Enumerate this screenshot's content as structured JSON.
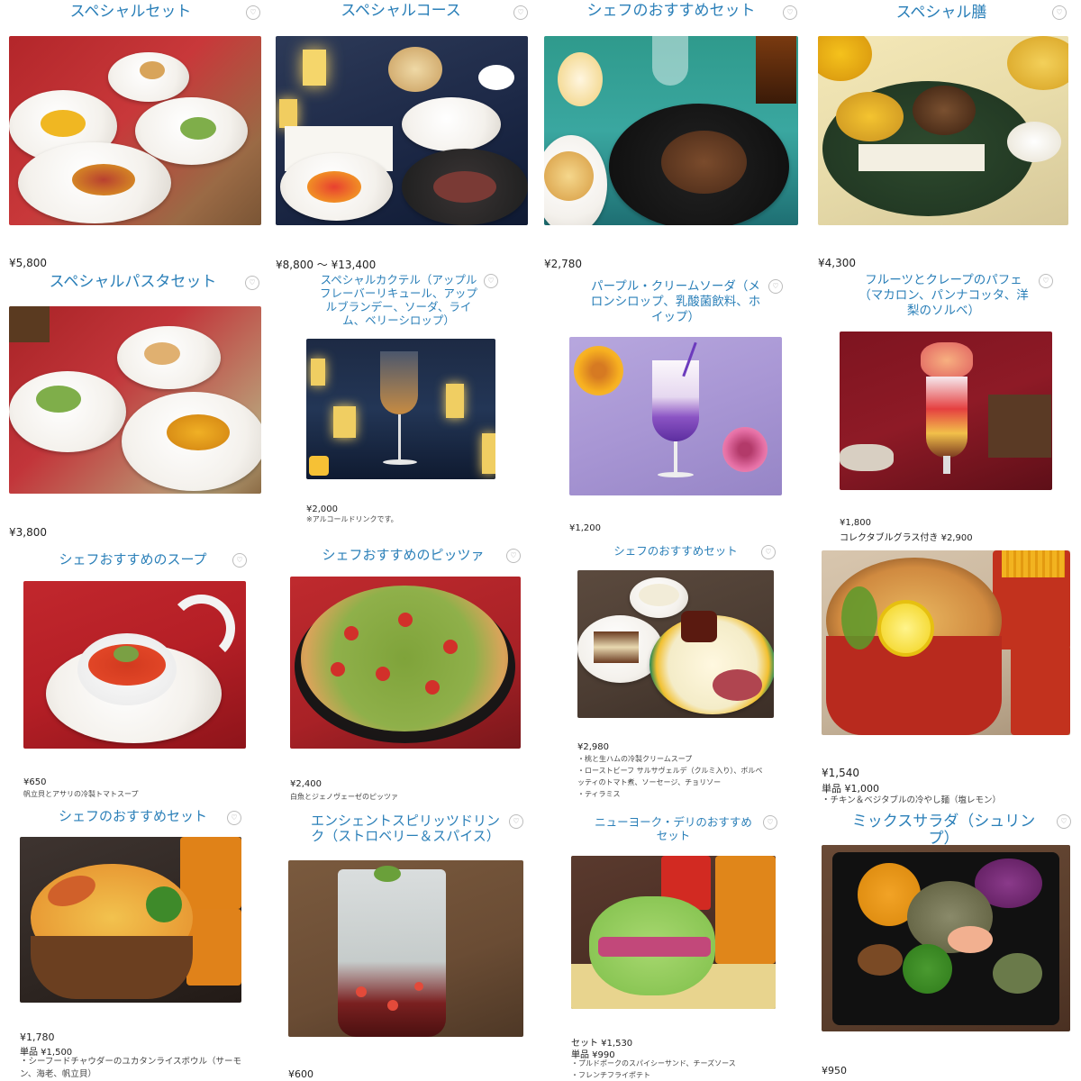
{
  "menu": [
    {
      "title": "スペシャルセット",
      "price": "¥5,800"
    },
    {
      "title": "スペシャルコース",
      "price": "¥8,800 〜 ¥13,400"
    },
    {
      "title": "シェフのおすすめセット",
      "price": "¥2,780"
    },
    {
      "title": "スペシャル膳",
      "price": "¥4,300"
    },
    {
      "title": "スペシャルパスタセット",
      "price": "¥3,800"
    },
    {
      "title": "スペシャルカクテル（アップル\nフレーバーリキュール、アップ\nルブランデー、ソーダ、ライ\nム、ベリーシロップ）",
      "price": "¥2,000",
      "note": "※アルコールドリンクです。"
    },
    {
      "title": "パープル・クリームソーダ（メ\nロンシロップ、乳酸菌飲料、ホ\nイップ）",
      "price": "¥1,200"
    },
    {
      "title": "フルーツとクレープのパフェ\n（マカロン、パンナコッタ、洋\n梨のソルベ）",
      "price": "¥1,800",
      "price2": "コレクタブルグラス付き ¥2,900"
    },
    {
      "title": "シェフおすすめのスープ",
      "price": "¥650",
      "note": "帆立貝とアサリの冷製トマトスープ"
    },
    {
      "title": "シェフおすすめのピッツァ",
      "price": "¥2,400",
      "note": "白魚とジェノヴェーゼのピッツァ"
    },
    {
      "title": "シェフのおすすめセット",
      "price": "¥2,980",
      "note": "・桃と生ハムの冷製クリームスープ\n・ローストビーフ サルサヴェルデ（クルミ入り）、ボルペ\nッティのトマト煮、ソーセージ、チョリソー\n・ティラミス"
    },
    {
      "title": "",
      "price": "¥1,540",
      "price2": "単品 ¥1,000",
      "note": "・チキン＆ベジタブルの冷やし麺（塩レモン）"
    },
    {
      "title": "シェフのおすすめセット",
      "price": "¥1,780",
      "price2": "単品 ¥1,500",
      "note": "・シーフードチャウダーのユカタンライスボウル（サーモ\nン、海老、帆立貝）"
    },
    {
      "title": "エンシェントスピリッツドリン\nク（ストロベリー＆スパイス）",
      "price": "¥600"
    },
    {
      "title": "ニューヨーク・デリのおすすめ\nセット",
      "price": "セット ¥1,530",
      "price2": "単品 ¥990",
      "note": "・プルドポークのスパイシーサンド、チーズソース\n・フレンチフライポテト"
    },
    {
      "title": "ミックスサラダ（シュリンプ）",
      "price": "¥950"
    }
  ],
  "icons": {
    "favorite": "heart-icon"
  },
  "colors": {
    "title": "#2a7fb8",
    "text": "#222222"
  }
}
